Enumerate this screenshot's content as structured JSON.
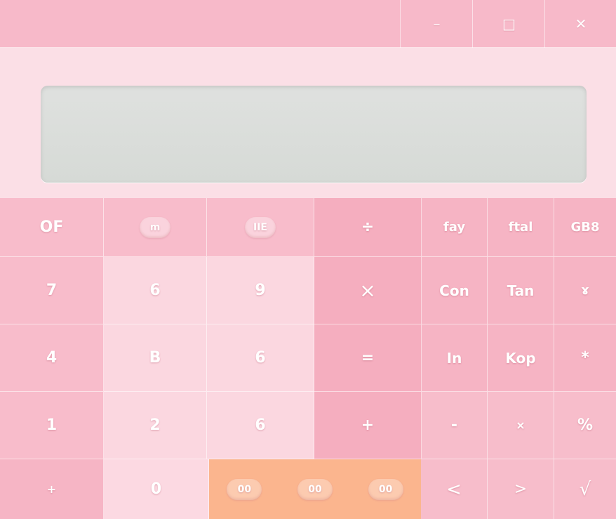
{
  "window": {
    "minimize_glyph": "–",
    "maximize_glyph": "□",
    "close_glyph": "✕"
  },
  "display": {
    "value": ""
  },
  "keys": {
    "row1": [
      "OF",
      "m",
      "IIE",
      "÷",
      "fay",
      "ftal",
      "GB8"
    ],
    "row2": [
      "7",
      "6",
      "9",
      "×",
      "Con",
      "Tan",
      "ɤ"
    ],
    "row3": [
      "4",
      "B",
      "6",
      "=",
      "In",
      "Kop",
      "*"
    ],
    "row4": [
      "1",
      "2",
      "6",
      "+",
      "-",
      "×",
      "%"
    ],
    "row5": [
      "+",
      "0",
      "⁀",
      "<",
      ">",
      "√"
    ],
    "orange": [
      "00",
      "00",
      "00"
    ]
  }
}
